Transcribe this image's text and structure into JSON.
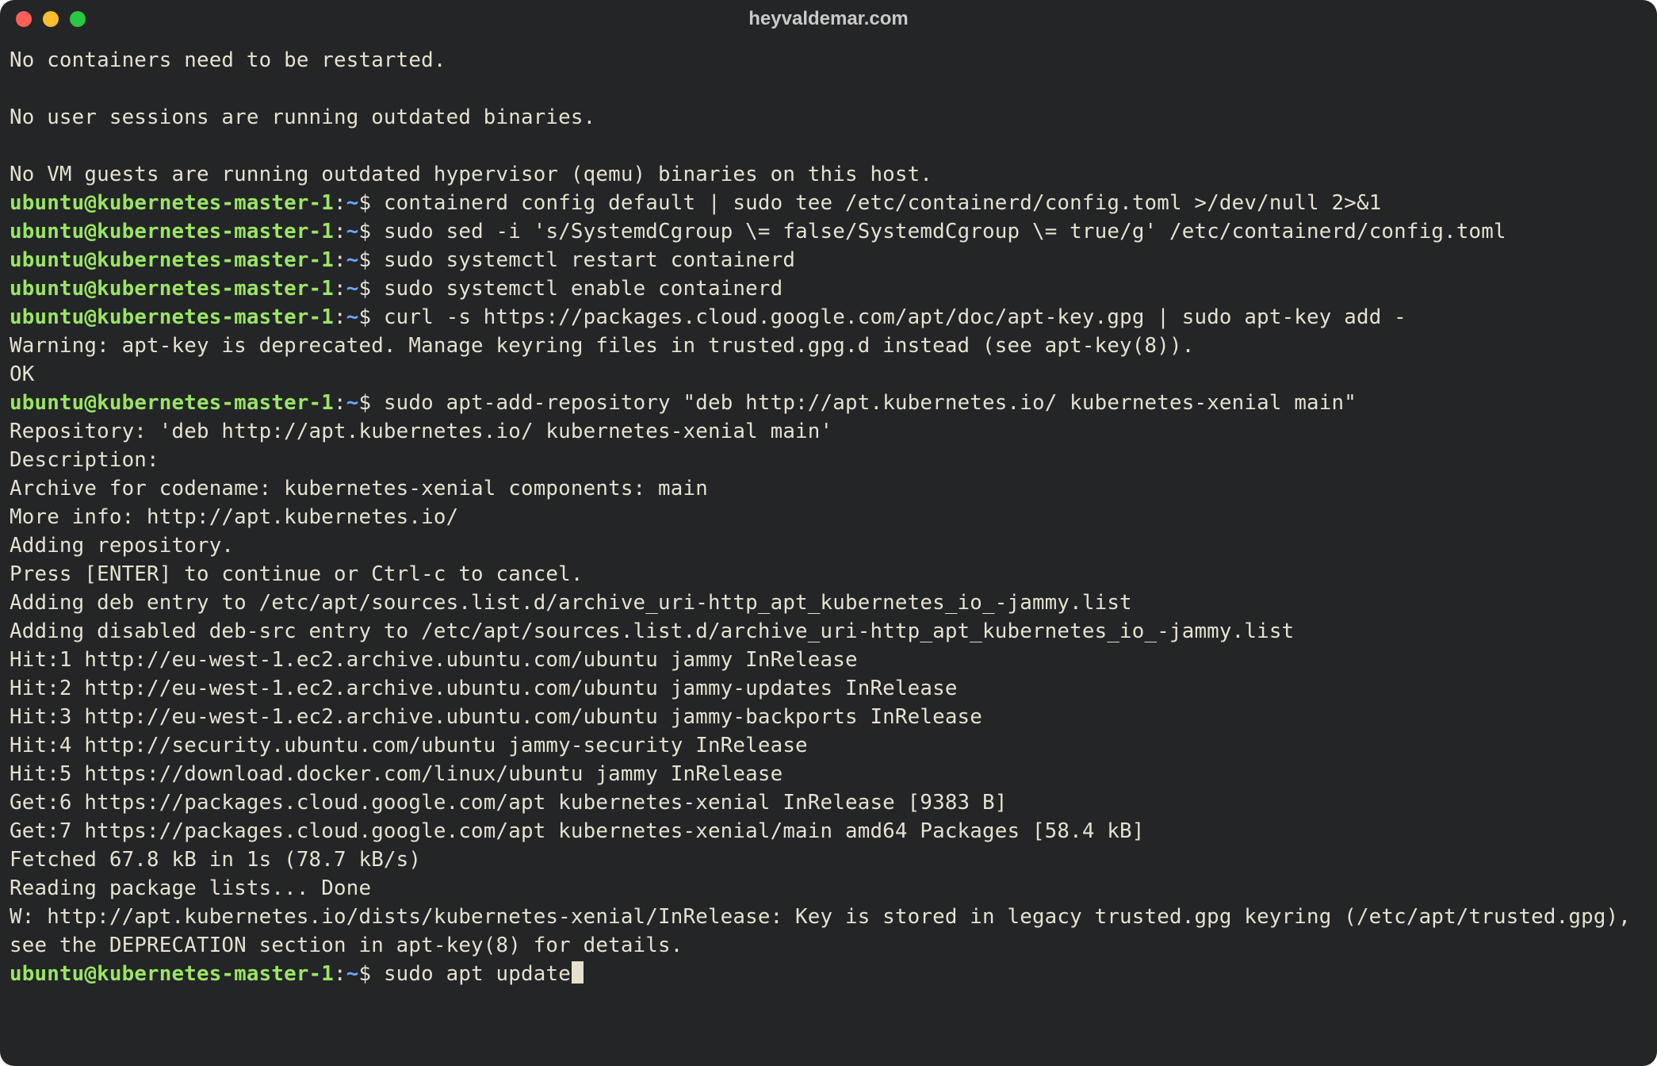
{
  "window": {
    "title": "heyvaldemar.com"
  },
  "prompt": {
    "user": "ubuntu",
    "at": "@",
    "host": "kubernetes-master-1",
    "colon": ":",
    "path": "~",
    "dollar": "$ "
  },
  "lines": [
    {
      "type": "out",
      "text": "No containers need to be restarted."
    },
    {
      "type": "blank"
    },
    {
      "type": "out",
      "text": "No user sessions are running outdated binaries."
    },
    {
      "type": "blank"
    },
    {
      "type": "out",
      "text": "No VM guests are running outdated hypervisor (qemu) binaries on this host."
    },
    {
      "type": "cmd",
      "text": "containerd config default | sudo tee /etc/containerd/config.toml >/dev/null 2>&1"
    },
    {
      "type": "cmd",
      "text": "sudo sed -i 's/SystemdCgroup \\= false/SystemdCgroup \\= true/g' /etc/containerd/config.toml"
    },
    {
      "type": "cmd",
      "text": "sudo systemctl restart containerd"
    },
    {
      "type": "cmd",
      "text": "sudo systemctl enable containerd"
    },
    {
      "type": "cmd",
      "text": "curl -s https://packages.cloud.google.com/apt/doc/apt-key.gpg | sudo apt-key add -"
    },
    {
      "type": "out",
      "text": "Warning: apt-key is deprecated. Manage keyring files in trusted.gpg.d instead (see apt-key(8))."
    },
    {
      "type": "out",
      "text": "OK"
    },
    {
      "type": "cmd",
      "text": "sudo apt-add-repository \"deb http://apt.kubernetes.io/ kubernetes-xenial main\""
    },
    {
      "type": "out",
      "text": "Repository: 'deb http://apt.kubernetes.io/ kubernetes-xenial main'"
    },
    {
      "type": "out",
      "text": "Description:"
    },
    {
      "type": "out",
      "text": "Archive for codename: kubernetes-xenial components: main"
    },
    {
      "type": "out",
      "text": "More info: http://apt.kubernetes.io/"
    },
    {
      "type": "out",
      "text": "Adding repository."
    },
    {
      "type": "out",
      "text": "Press [ENTER] to continue or Ctrl-c to cancel."
    },
    {
      "type": "out",
      "text": "Adding deb entry to /etc/apt/sources.list.d/archive_uri-http_apt_kubernetes_io_-jammy.list"
    },
    {
      "type": "out",
      "text": "Adding disabled deb-src entry to /etc/apt/sources.list.d/archive_uri-http_apt_kubernetes_io_-jammy.list"
    },
    {
      "type": "out",
      "text": "Hit:1 http://eu-west-1.ec2.archive.ubuntu.com/ubuntu jammy InRelease"
    },
    {
      "type": "out",
      "text": "Hit:2 http://eu-west-1.ec2.archive.ubuntu.com/ubuntu jammy-updates InRelease"
    },
    {
      "type": "out",
      "text": "Hit:3 http://eu-west-1.ec2.archive.ubuntu.com/ubuntu jammy-backports InRelease"
    },
    {
      "type": "out",
      "text": "Hit:4 http://security.ubuntu.com/ubuntu jammy-security InRelease"
    },
    {
      "type": "out",
      "text": "Hit:5 https://download.docker.com/linux/ubuntu jammy InRelease"
    },
    {
      "type": "out",
      "text": "Get:6 https://packages.cloud.google.com/apt kubernetes-xenial InRelease [9383 B]"
    },
    {
      "type": "out",
      "text": "Get:7 https://packages.cloud.google.com/apt kubernetes-xenial/main amd64 Packages [58.4 kB]"
    },
    {
      "type": "out",
      "text": "Fetched 67.8 kB in 1s (78.7 kB/s)"
    },
    {
      "type": "out",
      "text": "Reading package lists... Done"
    },
    {
      "type": "out",
      "text": "W: http://apt.kubernetes.io/dists/kubernetes-xenial/InRelease: Key is stored in legacy trusted.gpg keyring (/etc/apt/trusted.gpg), see the DEPRECATION section in apt-key(8) for details."
    },
    {
      "type": "cmd_cursor",
      "text": "sudo apt update"
    }
  ]
}
